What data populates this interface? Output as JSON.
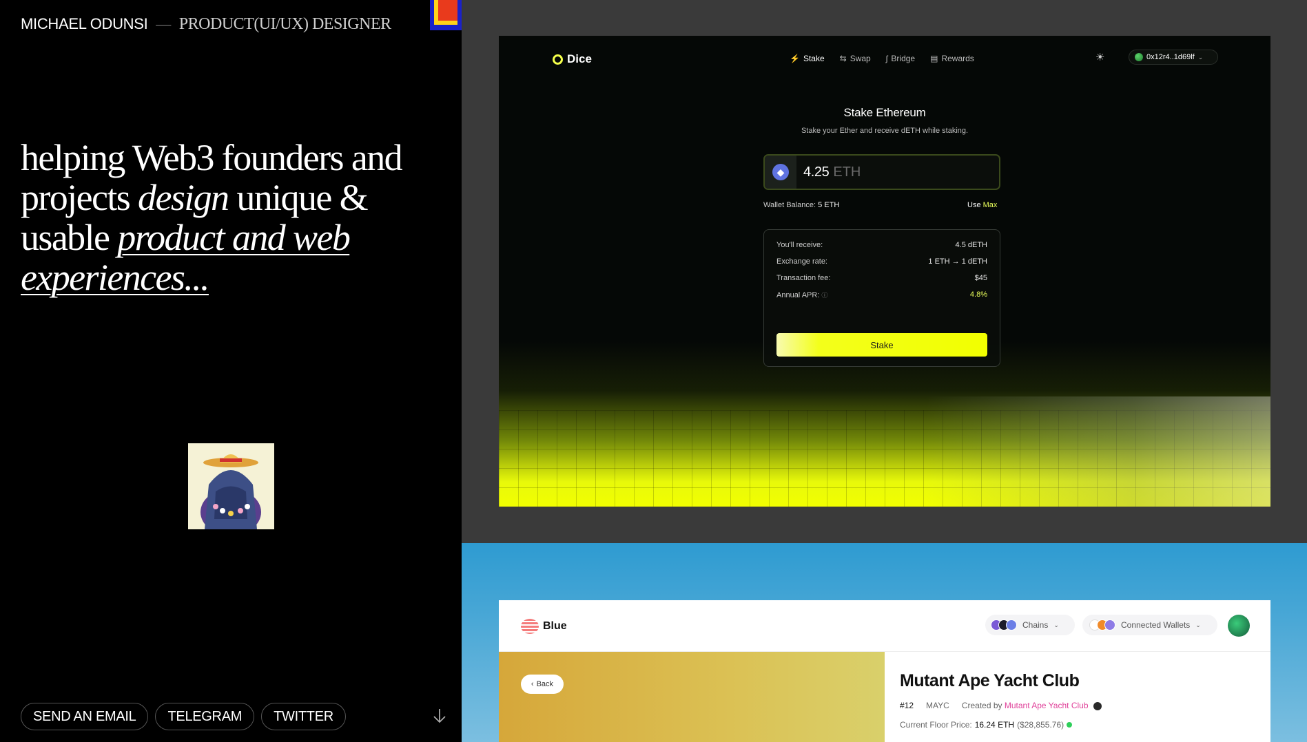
{
  "header": {
    "name": "MICHAEL ODUNSI",
    "dash": "—",
    "role": "PRODUCT(UI/UX) DESIGNER"
  },
  "hero": {
    "part1": "helping Web3 founders and projects ",
    "em1": "design",
    "part2": " unique & usable ",
    "em2": "product and web experiences..."
  },
  "links": [
    "SEND AN EMAIL",
    "TELEGRAM",
    "TWITTER"
  ],
  "dice": {
    "logo": "Dice",
    "nav": [
      {
        "label": "Stake",
        "icon": "⚡"
      },
      {
        "label": "Swap",
        "icon": "⇆"
      },
      {
        "label": "Bridge",
        "icon": "ʃ"
      },
      {
        "label": "Rewards",
        "icon": "▤"
      }
    ],
    "wallet": "0x12r4..1d69lf",
    "title": "Stake Ethereum",
    "subtitle": "Stake your Ether and receive dETH while staking.",
    "amount": "4.25",
    "unit": "ETH",
    "balance_label": "Wallet Balance:",
    "balance_value": "5 ETH",
    "use_label": "Use",
    "max_label": "Max",
    "rows": [
      {
        "label": "You'll receive:",
        "value": "4.5 dETH"
      },
      {
        "label": "Exchange rate:",
        "value": "1 ETH → 1 dETH"
      },
      {
        "label": "Transaction fee:",
        "value": "$45"
      },
      {
        "label": "Annual APR:",
        "value": "4.8%"
      }
    ],
    "stake_button": "Stake"
  },
  "blue": {
    "logo": "Blue",
    "chains": "Chains",
    "wallets": "Connected Wallets",
    "back": "Back",
    "title": "Mutant Ape Yacht Club",
    "id": "#12",
    "symbol": "MAYC",
    "created_by": "Created by",
    "creator": "Mutant Ape Yacht Club",
    "floor_label": "Current Floor Price:",
    "floor_value": "16.24 ETH",
    "floor_usd": "($28,855.76)"
  },
  "colors": {
    "accent_yellow": "#f2ff00",
    "blue_bg": "#2e9bd1",
    "creator_pink": "#e0429a"
  }
}
